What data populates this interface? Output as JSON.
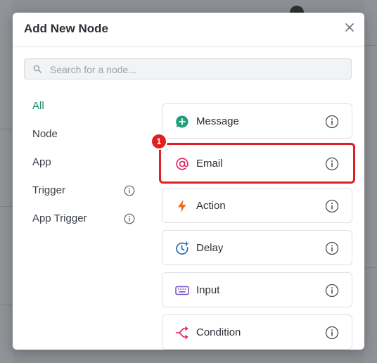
{
  "modal": {
    "title": "Add New Node",
    "close_icon": "close-icon"
  },
  "search": {
    "placeholder": "Search for a node...",
    "value": "",
    "icon": "search-icon"
  },
  "categories": [
    {
      "label": "All",
      "active": true,
      "has_info": false
    },
    {
      "label": "Node",
      "active": false,
      "has_info": false
    },
    {
      "label": "App",
      "active": false,
      "has_info": false
    },
    {
      "label": "Trigger",
      "active": false,
      "has_info": true
    },
    {
      "label": "App Trigger",
      "active": false,
      "has_info": true
    }
  ],
  "nodes": [
    {
      "label": "Message",
      "icon": "message-plus-icon",
      "color": "#1f9e7a"
    },
    {
      "label": "Email",
      "icon": "at-sign-icon",
      "color": "#e0245e",
      "highlighted": true
    },
    {
      "label": "Action",
      "icon": "lightning-bolt-icon",
      "color": "#f06a1a"
    },
    {
      "label": "Delay",
      "icon": "clock-plus-icon",
      "color": "#2b6cb0"
    },
    {
      "label": "Input",
      "icon": "keyboard-icon",
      "color": "#7b4fc9"
    },
    {
      "label": "Condition",
      "icon": "split-arrows-icon",
      "color": "#e0245e"
    }
  ],
  "annotation": {
    "badge": "1"
  },
  "colors": {
    "accent": "#1f8a6e",
    "highlight": "#e02020"
  }
}
